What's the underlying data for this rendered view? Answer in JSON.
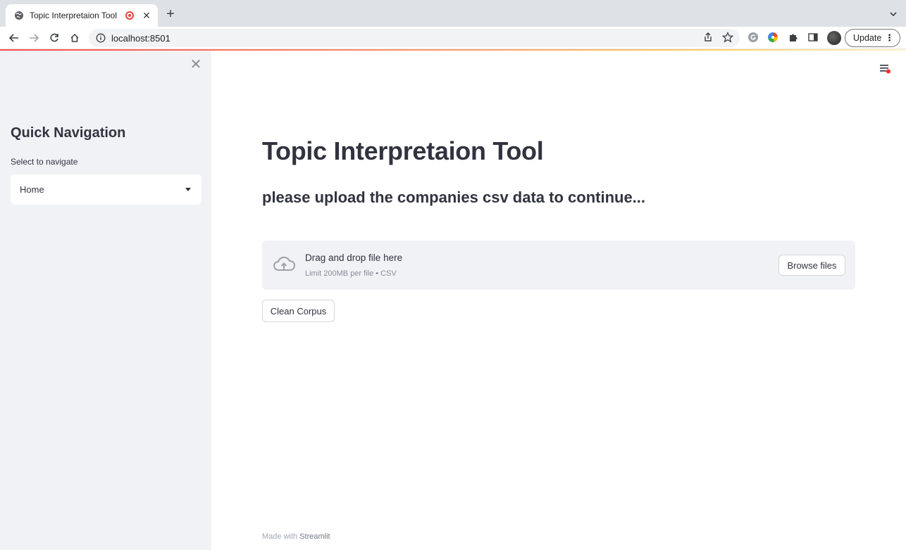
{
  "browser": {
    "tab_title": "Topic Interpretaion Tool",
    "url": "localhost:8501",
    "update_label": "Update",
    "icons": [
      "globe-icon",
      "record-icon",
      "close-icon",
      "plus-icon",
      "back-icon",
      "forward-icon",
      "reload-icon",
      "home-icon",
      "info-icon",
      "share-icon",
      "star-icon",
      "extensions-icon",
      "side-panel-icon",
      "more-icon"
    ]
  },
  "sidebar": {
    "heading": "Quick Navigation",
    "select_label": "Select to navigate",
    "select_value": "Home"
  },
  "main": {
    "title": "Topic Interpretaion Tool",
    "subtitle": "please upload the companies csv data to continue...",
    "uploader": {
      "drag_text": "Drag and drop file here",
      "limit_text": "Limit 200MB per file • CSV",
      "browse_label": "Browse files"
    },
    "clean_button": "Clean Corpus"
  },
  "footer": {
    "prefix": "Made with",
    "brand": "Streamlit"
  },
  "colors": {
    "accent": "#ff4b4b",
    "sidebar_bg": "#f0f2f6",
    "text": "#31333f"
  }
}
